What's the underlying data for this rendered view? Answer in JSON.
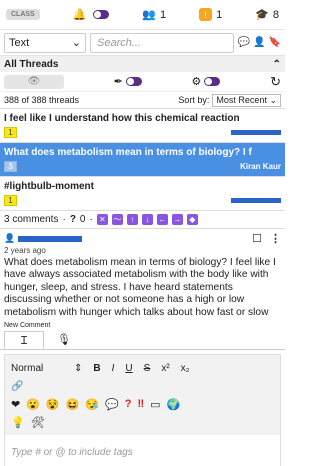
{
  "topbar": {
    "class_label": "CLASS",
    "group_count": "1",
    "badge_value": "!",
    "badge_count": "1",
    "cap_count": "8"
  },
  "search": {
    "type_value": "Text",
    "placeholder": "Search..."
  },
  "threads": {
    "header": "All Threads",
    "count_text": "388 of 388 threads",
    "sort_label": "Sort by:",
    "sort_value": "Most Recent",
    "items": [
      {
        "title": "I feel like I understand how this chemical reaction",
        "badge": "1"
      },
      {
        "title": "What does metabolism mean in terms of biology? I f",
        "badge": "3",
        "author": "Kiran Kaur"
      },
      {
        "title": "#lightbulb-moment",
        "badge": "1"
      }
    ]
  },
  "stats": {
    "comments": "3 comments",
    "separator": "·",
    "questions": "0",
    "dot": "·"
  },
  "post": {
    "time": "2 years ago",
    "body": "What does metabolism mean in terms of biology? I feel like I have always associated metabolism with the body like with hunger, sleep, and stress. I have heard statements discussing whether or not someone has a high or low metabolism with hunger which talks about how fast or slow someone can break down food. Personally, I am assuming that"
  },
  "composer": {
    "label": "New Comment",
    "format": "Normal",
    "bold": "B",
    "italic": "I",
    "underline": "U",
    "strike": "S",
    "sup": "x²",
    "sub": "x₂",
    "tags_placeholder": "Type # or @ to include tags"
  },
  "colors": {
    "purple": "#5b2d86",
    "active_thread": "#4a90e2",
    "user_bar": "#2a64c8",
    "yellow_badge": "#f8e71c"
  }
}
